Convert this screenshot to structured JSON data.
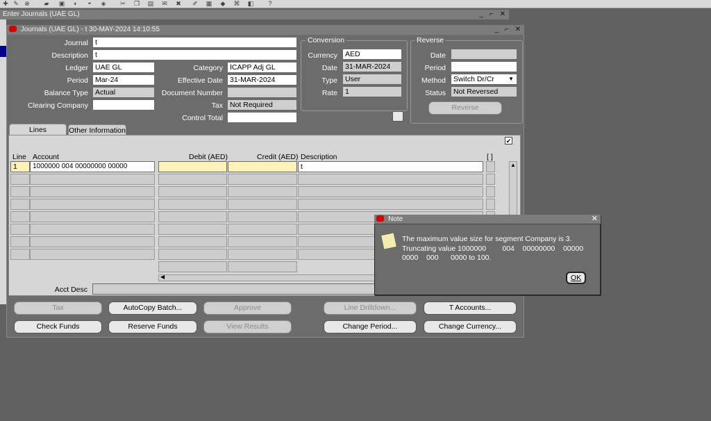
{
  "app": {
    "outer_title": "Enter Journals (UAE GL)",
    "inner_title": "Journals (UAE GL) - t 30-MAY-2024 14:10:55"
  },
  "header": {
    "journal_label": "Journal",
    "journal_value": "t",
    "description_label": "Description",
    "description_value": "t",
    "ledger_label": "Ledger",
    "ledger_value": "UAE GL",
    "period_label": "Period",
    "period_value": "Mar-24",
    "balance_type_label": "Balance Type",
    "balance_type_value": "Actual",
    "clearing_company_label": "Clearing Company",
    "clearing_company_value": "",
    "category_label": "Category",
    "category_value": "ICAPP Adj GL",
    "effective_date_label": "Effective Date",
    "effective_date_value": "31-MAR-2024",
    "document_number_label": "Document Number",
    "document_number_value": "",
    "tax_label": "Tax",
    "tax_value": "Not Required",
    "control_total_label": "Control Total",
    "control_total_value": ""
  },
  "conversion": {
    "title": "Conversion",
    "currency_label": "Currency",
    "currency_value": "AED",
    "date_label": "Date",
    "date_value": "31-MAR-2024",
    "type_label": "Type",
    "type_value": "User",
    "rate_label": "Rate",
    "rate_value": "1"
  },
  "reverse": {
    "title": "Reverse",
    "date_label": "Date",
    "date_value": "",
    "period_label": "Period",
    "period_value": "",
    "method_label": "Method",
    "method_value": "Switch Dr/Cr",
    "status_label": "Status",
    "status_value": "Not Reversed",
    "reverse_button": "Reverse"
  },
  "tabs": {
    "lines": "Lines",
    "other_information": "Other Information"
  },
  "lines": {
    "col_line": "Line",
    "col_account": "Account",
    "col_debit": "Debit (AED)",
    "col_credit": "Credit (AED)",
    "col_description": "Description",
    "col_folder": "[ ]",
    "row1_line": "1",
    "row1_account": "1000000          004  00000000       00000",
    "row1_debit": "",
    "row1_credit": "",
    "row1_description": "t",
    "acct_desc_label": "Acct Desc",
    "acct_desc_value": ""
  },
  "buttons": {
    "tax": "Tax",
    "autocopy_batch": "AutoCopy Batch...",
    "approve": "Approve",
    "line_drilldown": "Line Drilldown...",
    "t_accounts": "T Accounts...",
    "check_funds": "Check Funds",
    "reserve_funds": "Reserve Funds",
    "view_results": "View Results",
    "change_period": "Change Period...",
    "change_currency": "Change Currency..."
  },
  "note": {
    "title": "Note",
    "message": "The maximum value size for segment Company is 3. Truncating value 1000000        004    00000000    00000    0000    000      0000 to 100.",
    "ok_button": "OK"
  },
  "misc": {
    "bracket_button": "[ ]"
  }
}
